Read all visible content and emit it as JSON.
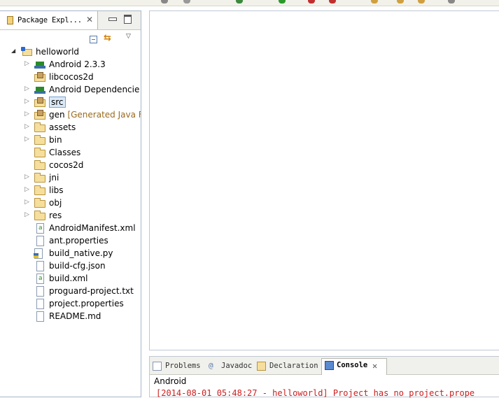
{
  "package_explorer": {
    "tab_title": "Package Expl...",
    "tree": [
      {
        "label": "helloworld",
        "decoration": "",
        "icon": "project-icon",
        "toggle": "expanded",
        "indent": 0
      },
      {
        "label": "Android 2.3.3",
        "decoration": "",
        "icon": "library-icon",
        "toggle": "collapsed",
        "indent": 1
      },
      {
        "label": "libcocos2d",
        "decoration": "",
        "icon": "package-folder-icon",
        "toggle": "none",
        "indent": 1
      },
      {
        "label": "Android Dependencie",
        "decoration": "",
        "icon": "library-icon",
        "toggle": "collapsed",
        "indent": 1
      },
      {
        "label": "src",
        "decoration": "",
        "icon": "source-folder-icon",
        "toggle": "collapsed",
        "indent": 1,
        "selected": true
      },
      {
        "label": "gen",
        "decoration": "[Generated Java F",
        "icon": "source-folder-icon",
        "toggle": "collapsed",
        "indent": 1
      },
      {
        "label": "assets",
        "decoration": "",
        "icon": "folder-icon",
        "toggle": "collapsed",
        "indent": 1
      },
      {
        "label": "bin",
        "decoration": "",
        "icon": "folder-icon",
        "toggle": "collapsed",
        "indent": 1
      },
      {
        "label": "Classes",
        "decoration": "",
        "icon": "folder-icon",
        "toggle": "none",
        "indent": 1
      },
      {
        "label": "cocos2d",
        "decoration": "",
        "icon": "folder-icon",
        "toggle": "none",
        "indent": 1
      },
      {
        "label": "jni",
        "decoration": "",
        "icon": "folder-icon",
        "toggle": "collapsed",
        "indent": 1
      },
      {
        "label": "libs",
        "decoration": "",
        "icon": "folder-icon",
        "toggle": "collapsed",
        "indent": 1
      },
      {
        "label": "obj",
        "decoration": "",
        "icon": "folder-icon",
        "toggle": "collapsed",
        "indent": 1
      },
      {
        "label": "res",
        "decoration": "",
        "icon": "folder-icon",
        "toggle": "collapsed",
        "indent": 1
      },
      {
        "label": "AndroidManifest.xml",
        "decoration": "",
        "icon": "xml-file-icon",
        "toggle": "none",
        "indent": 1
      },
      {
        "label": "ant.properties",
        "decoration": "",
        "icon": "file-icon",
        "toggle": "none",
        "indent": 1
      },
      {
        "label": "build_native.py",
        "decoration": "",
        "icon": "python-file-icon",
        "toggle": "none",
        "indent": 1
      },
      {
        "label": "build-cfg.json",
        "decoration": "",
        "icon": "file-icon",
        "toggle": "none",
        "indent": 1
      },
      {
        "label": "build.xml",
        "decoration": "",
        "icon": "xml-file-icon",
        "toggle": "none",
        "indent": 1
      },
      {
        "label": "proguard-project.txt",
        "decoration": "",
        "icon": "file-icon",
        "toggle": "none",
        "indent": 1
      },
      {
        "label": "project.properties",
        "decoration": "",
        "icon": "file-icon",
        "toggle": "none",
        "indent": 1
      },
      {
        "label": "README.md",
        "decoration": "",
        "icon": "file-icon",
        "toggle": "none",
        "indent": 1
      }
    ]
  },
  "bottom_panel": {
    "tabs": [
      {
        "label": "Problems",
        "icon": "problems-icon"
      },
      {
        "label": "Javadoc",
        "icon": "javadoc-icon"
      },
      {
        "label": "Declaration",
        "icon": "declaration-icon"
      },
      {
        "label": "Console",
        "icon": "console-icon",
        "active": true
      }
    ],
    "console_name": "Android",
    "console_line": "[2014-08-01 05:48:27 - helloworld] Project has no project.prope"
  }
}
